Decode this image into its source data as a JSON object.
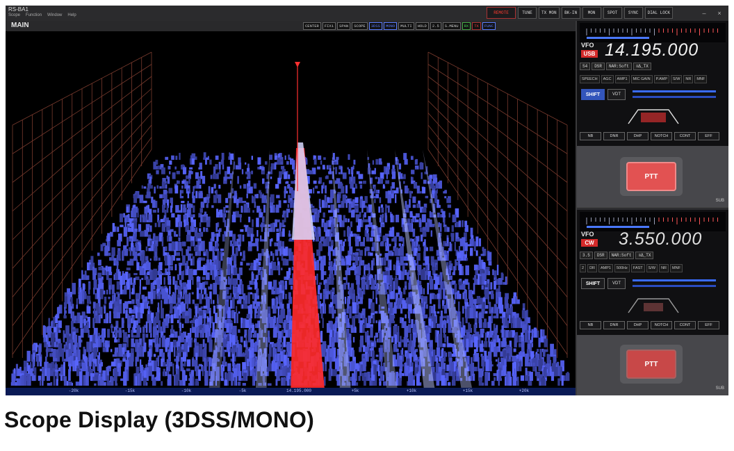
{
  "titlebar": {
    "logo": "RS-BA1",
    "menu": [
      "Scope",
      "Function",
      "Window",
      "Help"
    ],
    "buttons": [
      {
        "label": "REMOTE",
        "style": "red"
      },
      {
        "label": "TUNE",
        "style": "normal"
      },
      {
        "label": "TX MON",
        "style": "normal"
      },
      {
        "label": "BK-IN",
        "style": "normal"
      },
      {
        "label": "MON",
        "style": "normal"
      },
      {
        "label": "SPOT",
        "style": "normal"
      },
      {
        "label": "SYNC",
        "style": "normal"
      },
      {
        "label": "DIAL LOCK",
        "style": "normal"
      }
    ],
    "win_controls": [
      "–",
      "×"
    ]
  },
  "scope": {
    "title": "MAIN",
    "toolbar": [
      {
        "label": "CENTER",
        "style": "normal"
      },
      {
        "label": "FIX1",
        "style": "normal"
      },
      {
        "label": "SPAN",
        "style": "normal"
      },
      {
        "label": "SCOPE",
        "style": "normal"
      },
      {
        "label": "3DSS",
        "style": "blue"
      },
      {
        "label": "MONO",
        "style": "blue"
      },
      {
        "label": "MULTI",
        "style": "normal"
      },
      {
        "label": "HOLD",
        "style": "normal"
      },
      {
        "label": "2.5",
        "style": "normal"
      },
      {
        "label": "S.MENU",
        "style": "normal"
      },
      {
        "label": "RX",
        "style": "green"
      },
      {
        "label": "TX",
        "style": "redc"
      },
      {
        "label": "FUNC",
        "style": "blue"
      }
    ],
    "freq_axis": [
      "-20k",
      "-15k",
      "-10k",
      "-5k",
      "14.195.000",
      "+5k",
      "+10k",
      "+15k",
      "+20k"
    ]
  },
  "main_vfo": {
    "label": "VFO",
    "mode": "USB",
    "frequency": "14.195.000",
    "info": [
      "S4",
      "DSR",
      "NAR:Soft",
      "≡Δ_TX"
    ],
    "row1": [
      "SPEECH",
      "AGC",
      "AMP1",
      "MIC GAIN",
      "P.AMP",
      "S/W",
      "NR",
      "MNF"
    ],
    "shift": "SHIFT",
    "vdt": "VDT",
    "funcs": [
      "NB",
      "DNR",
      "DHP",
      "NOTCH",
      "CONT",
      "EFF"
    ],
    "ptt": "PTT",
    "sub": "SUB"
  },
  "sub_vfo": {
    "label": "VFO",
    "mode": "CW",
    "frequency": "3.550.000",
    "info": [
      "3.5",
      "DSR",
      "NAR:Soft",
      "≡Δ_TX"
    ],
    "row1": [
      "2",
      "DR",
      "AMP1",
      "500Hz",
      "FAST",
      "S/W",
      "NR",
      "MNF"
    ],
    "shift": "SHIFT",
    "vdt": "VDT",
    "funcs": [
      "NB",
      "DNR",
      "DHP",
      "NOTCH",
      "CONT",
      "EFF"
    ],
    "ptt": "PTT",
    "sub": "SUB"
  },
  "caption": "Scope Display (3DSS/MONO)",
  "colors": {
    "accent": "#3355bb",
    "signal": "#ff2a2a",
    "trace": "#5a6cff"
  }
}
